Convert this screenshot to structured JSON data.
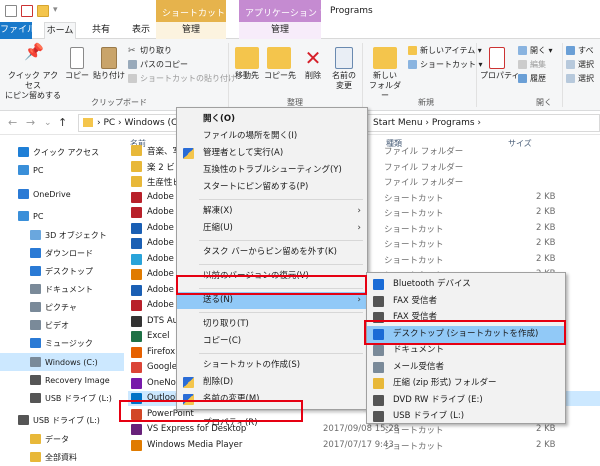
{
  "titlebar": {
    "title": "Programs",
    "ctx_tab_shortcut": "ショートカット ツール",
    "ctx_tab_app": "アプリケーション ツール"
  },
  "tabs": {
    "file": "ファイル",
    "home": "ホーム",
    "share": "共有",
    "view": "表示",
    "manage1": "管理",
    "manage2": "管理"
  },
  "ribbon": {
    "pin": "クイック アクセス\nにピン留めする",
    "copy": "コピー",
    "paste": "貼り付け",
    "cut": "切り取り",
    "copy_path": "パスのコピー",
    "paste_shortcut": "ショートカットの貼り付け",
    "clipboard": "クリップボード",
    "move_to": "移動先",
    "copy_to": "コピー先",
    "delete": "削除",
    "rename": "名前の\n変更",
    "organize": "整理",
    "new_folder": "新しい\nフォルダー",
    "new_item": "新しいアイテム ▾",
    "easy_access": "ショートカット ▾",
    "new_group": "新規",
    "properties": "プロパティ",
    "open": "開く ▾",
    "edit": "編集",
    "history": "履歴",
    "open_group": "開く",
    "select_all": "すべ",
    "select_none": "選択",
    "invert": "選択"
  },
  "address": {
    "path": "›  PC  ›  Windows (C:)",
    "path_tail": "Start Menu  ›  Programs  ›"
  },
  "nav": [
    {
      "label": "クイック アクセス",
      "color": "#1f7fd6"
    },
    {
      "label": "PC",
      "color": "#3a8fd9"
    },
    {
      "label": "OneDrive",
      "color": "#2a7ad5"
    },
    {
      "label": "PC",
      "color": "#3a8fd9"
    },
    {
      "label": "3D オブジェクト",
      "color": "#6aa7de"
    },
    {
      "label": "ダウンロード",
      "color": "#2a7ad5"
    },
    {
      "label": "デスクトップ",
      "color": "#2a7ad5"
    },
    {
      "label": "ドキュメント",
      "color": "#7a8a99"
    },
    {
      "label": "ピクチャ",
      "color": "#7a8a99"
    },
    {
      "label": "ビデオ",
      "color": "#7a8a99"
    },
    {
      "label": "ミュージック",
      "color": "#2a7ad5"
    },
    {
      "label": "Windows (C:)",
      "color": "#7a8a99"
    },
    {
      "label": "Recovery Image",
      "color": "#555"
    },
    {
      "label": "USB ドライブ (L:)",
      "color": "#555"
    },
    {
      "label": "USB ドライブ (L:)",
      "color": "#555"
    },
    {
      "label": "データ",
      "color": "#e8b839"
    },
    {
      "label": "全部資料",
      "color": "#e8b839"
    }
  ],
  "columns": {
    "name": "名前",
    "type": "種類",
    "size": "サイズ"
  },
  "rows": [
    {
      "name": "音楽、写",
      "date": "",
      "type": "ファイル フォルダー",
      "size": "",
      "color": "#e8b839"
    },
    {
      "name": "楽 2 ビュ",
      "date": "",
      "type": "ファイル フォルダー",
      "size": "",
      "color": "#e8b839"
    },
    {
      "name": "生産性ピ",
      "date": "",
      "type": "ファイル フォルダー",
      "size": "",
      "color": "#e8b839"
    },
    {
      "name": "Adobe B",
      "date": ":43",
      "type": "ショートカット",
      "size": "2 KB",
      "color": "#b8202a"
    },
    {
      "name": "Adobe B",
      "date": ":43",
      "type": "ショートカット",
      "size": "2 KB",
      "color": "#b8202a"
    },
    {
      "name": "Adobe E",
      "date": ":43",
      "type": "ショートカット",
      "size": "2 KB",
      "color": "#1a5fb4"
    },
    {
      "name": "Adobe E",
      "date": ":43",
      "type": "ショートカット",
      "size": "2 KB",
      "color": "#1a5fb4"
    },
    {
      "name": "Adobe H",
      "date": ":43",
      "type": "ショートカット",
      "size": "2 KB",
      "color": "#29a3d9"
    },
    {
      "name": "Adobe Ill",
      "date": ":43",
      "type": "ショートカット",
      "size": "2 KB",
      "color": "#e07b00"
    },
    {
      "name": "Adobe P",
      "date": ":43",
      "type": "ショートカット",
      "size": "2 KB",
      "color": "#1a5fb4"
    },
    {
      "name": "Adobe R",
      "date": ":43",
      "type": "ショートカット",
      "size": "2 KB",
      "color": "#b8202a"
    },
    {
      "name": "DTS Aud",
      "date": "",
      "type": "",
      "size": "",
      "color": "#333"
    },
    {
      "name": "Excel",
      "date": "",
      "type": "",
      "size": "",
      "color": "#1e7145"
    },
    {
      "name": "Firefox",
      "date": "",
      "type": "",
      "size": "",
      "color": "#e66000"
    },
    {
      "name": "Google C",
      "date": "",
      "type": "",
      "size": "",
      "color": "#db4437"
    },
    {
      "name": "OneNote",
      "date": "",
      "type": "",
      "size": "",
      "color": "#7719aa"
    },
    {
      "name": "Outlook",
      "date": "2019/01/24 9:",
      "date_hidden": true,
      "type": "",
      "size": "",
      "color": "#0072c6"
    },
    {
      "name": "PowerPoint",
      "date": "",
      "type": "",
      "size": "",
      "color": "#d24726"
    },
    {
      "name": "VS Express for Desktop",
      "date": "2017/09/08 15:28",
      "type": "ショートカット",
      "size": "2 KB",
      "color": "#68217a"
    },
    {
      "name": "Windows Media Player",
      "date": "2017/07/17 9:43",
      "type": "ショートカット",
      "size": "2 KB",
      "color": "#e07b00"
    }
  ],
  "context_menu": [
    {
      "label": "開く(O)",
      "bold": true
    },
    {
      "label": "ファイルの場所を開く(I)"
    },
    {
      "label": "管理者として実行(A)",
      "icon": "shield-icon"
    },
    {
      "label": "互換性のトラブルシューティング(Y)"
    },
    {
      "label": "スタートにピン留めする(P)"
    },
    {
      "sep": true
    },
    {
      "label": "解凍(X)",
      "sub": true
    },
    {
      "label": "圧縮(U)",
      "sub": true
    },
    {
      "sep": true
    },
    {
      "label": "タスク バーからピン留めを外す(K)"
    },
    {
      "sep": true
    },
    {
      "label": "以前のバージョンの復元(V)"
    },
    {
      "sep": true
    },
    {
      "label": "送る(N)",
      "sub": true,
      "hot": true
    },
    {
      "sep": true
    },
    {
      "label": "切り取り(T)"
    },
    {
      "label": "コピー(C)"
    },
    {
      "sep": true
    },
    {
      "label": "ショートカットの作成(S)"
    },
    {
      "label": "削除(D)",
      "icon": "shield-icon"
    },
    {
      "label": "名前の変更(M)",
      "icon": "shield-icon"
    },
    {
      "sep": true
    },
    {
      "label": "プロパティ(R)"
    }
  ],
  "sendto_menu": [
    {
      "label": "Bluetooth デバイス",
      "color": "#1a6bd6"
    },
    {
      "label": "FAX 受信者",
      "color": "#555"
    },
    {
      "label": "FAX 受信者",
      "color": "#555"
    },
    {
      "label": "デスクトップ (ショートカットを作成)",
      "color": "#1a6bd6",
      "hot": true
    },
    {
      "label": "ドキュメント",
      "color": "#7a8a99"
    },
    {
      "label": "メール受信者",
      "color": "#7a8a99"
    },
    {
      "label": "圧縮 (zip 形式) フォルダー",
      "color": "#e8b839"
    },
    {
      "label": "DVD RW ドライブ (E:)",
      "color": "#555"
    },
    {
      "label": "USB ドライブ (L:)",
      "color": "#555"
    }
  ]
}
